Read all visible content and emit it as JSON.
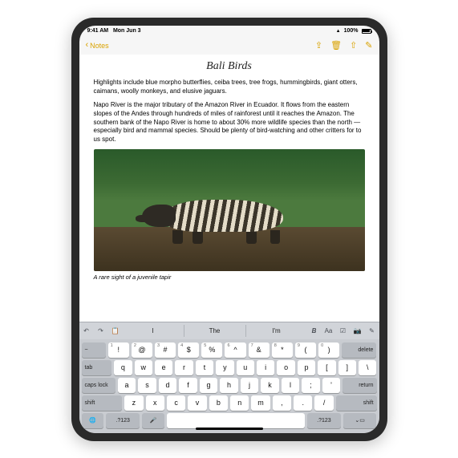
{
  "status": {
    "time": "9:41 AM",
    "date": "Mon Jun 3",
    "battery": "100%"
  },
  "nav": {
    "back": "Notes",
    "title": "Bali Birds",
    "icons": [
      "folder-arrow",
      "trash",
      "share",
      "compose"
    ]
  },
  "note": {
    "heading": "Bali Birds",
    "p1": "Highlights include blue morpho butterflies, ceiba trees, tree frogs, hummingbirds, giant otters, caimans, woolly monkeys, and elusive jaguars.",
    "p2": "Napo River is the major tributary of the Amazon River in Ecuador. It flows from the eastern slopes of the Andes through hundreds of miles of rainforest until it reaches the Amazon. The southern bank of the Napo River is home to about 30% more wildlife species than the north — especially bird and mammal species. Should be plenty of bird-watching and other critters for to us spot.",
    "caption": "A rare sight of a juvenile tapir",
    "image_subject": "juvenile tapir in forest"
  },
  "suggestions": {
    "left_tools": [
      "undo",
      "redo",
      "clipboard"
    ],
    "items": [
      "I",
      "The",
      "I'm"
    ],
    "right_tools": [
      "bold-italic",
      "font",
      "checklist",
      "camera",
      "note"
    ]
  },
  "keyboard": {
    "row_num_alt": [
      "1",
      "2",
      "3",
      "4",
      "5",
      "6",
      "7",
      "8",
      "9",
      "0"
    ],
    "row_num_main": [
      "!",
      "@",
      "#",
      "$",
      "%",
      "^",
      "&",
      "*",
      "(",
      ")"
    ],
    "row1": [
      "q",
      "w",
      "e",
      "r",
      "t",
      "y",
      "u",
      "i",
      "o",
      "p"
    ],
    "row1_punc_left": "[",
    "row1_punc_right_a": "]",
    "row1_punc_right_b": "\\",
    "row2": [
      "a",
      "s",
      "d",
      "f",
      "g",
      "h",
      "j",
      "k",
      "l"
    ],
    "row2_punc_a": ";",
    "row2_punc_b": "'",
    "row3": [
      "z",
      "x",
      "c",
      "v",
      "b",
      "n",
      "m"
    ],
    "row3_punc_a": ",",
    "row3_punc_b": ".",
    "row3_punc_c": "/",
    "labels": {
      "tilde": "~",
      "tab": "tab",
      "caps": "caps lock",
      "shift": "shift",
      "globe": "🌐",
      "num": ".?123",
      "mic": "🎤",
      "delete": "delete",
      "return": "return",
      "hide": "⌄▭"
    }
  }
}
